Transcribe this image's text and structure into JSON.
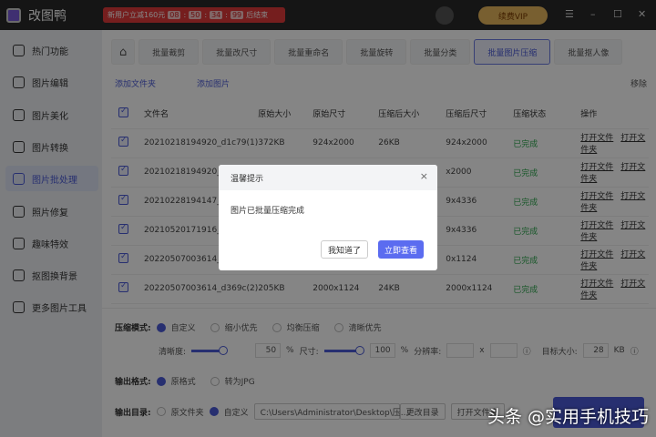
{
  "app": {
    "name": "改图鸭",
    "promo_text": "新用户立减160元",
    "countdown": [
      "08",
      "50",
      "34",
      "99"
    ],
    "promo_suffix": "后结束",
    "vip": "续费VIP",
    "window_controls": [
      "☰",
      "–",
      "☐",
      "✕"
    ]
  },
  "sidebar": {
    "items": [
      {
        "label": "热门功能"
      },
      {
        "label": "图片编辑"
      },
      {
        "label": "图片美化"
      },
      {
        "label": "图片转换"
      },
      {
        "label": "图片批处理",
        "active": true
      },
      {
        "label": "照片修复"
      },
      {
        "label": "趣味特效"
      },
      {
        "label": "抠图换背景"
      },
      {
        "label": "更多图片工具"
      }
    ]
  },
  "tabs": {
    "home": "⌂",
    "items": [
      "批量裁剪",
      "批量改尺寸",
      "批量重命名",
      "批量旋转",
      "批量分类",
      "批量图片压缩",
      "批量抠人像"
    ],
    "active": "批量图片压缩"
  },
  "toolbar": {
    "add_folder": "添加文件夹",
    "add_image": "添加图片",
    "remove": "移除"
  },
  "table": {
    "headers": [
      "文件名",
      "原始大小",
      "原始尺寸",
      "压缩后大小",
      "压缩后尺寸",
      "压缩状态",
      "操作"
    ],
    "rows": [
      {
        "name": "20210218194920_d1c79(1)",
        "size": "372KB",
        "dim": "924x2000",
        "csize": "26KB",
        "cdim": "924x2000",
        "status": "已完成"
      },
      {
        "name": "20210218194920_d1",
        "size": "",
        "dim": "",
        "csize": "",
        "cdim": "x2000",
        "status": "已完成"
      },
      {
        "name": "20210228194147_e1",
        "size": "",
        "dim": "",
        "csize": "",
        "cdim": "9x4336",
        "status": "已完成"
      },
      {
        "name": "20210520171916_19",
        "size": "",
        "dim": "",
        "csize": "",
        "cdim": "9x4336",
        "status": "已完成"
      },
      {
        "name": "20220507003614_d3",
        "size": "",
        "dim": "",
        "csize": "",
        "cdim": "0x1124",
        "status": "已完成"
      },
      {
        "name": "20220507003614_d369c(2)",
        "size": "205KB",
        "dim": "2000x1124",
        "csize": "24KB",
        "cdim": "2000x1124",
        "status": "已完成"
      }
    ],
    "open_file": "打开文件",
    "open_folder": "打开文件夹"
  },
  "settings": {
    "mode_label": "压缩模式:",
    "modes": [
      "自定义",
      "缩小优先",
      "均衡压缩",
      "清晰优先"
    ],
    "clarity_label": "清晰度:",
    "clarity_value": "50",
    "clarity_pct": 50,
    "size_label": "尺寸:",
    "size_value": "100",
    "size_pct": 100,
    "percent": "%",
    "resolution_label": "分辨率:",
    "x": "x",
    "target_label": "目标大小:",
    "target_value": "28",
    "target_unit": "KB",
    "format_label": "输出格式:",
    "formats": [
      "原格式",
      "转为JPG"
    ],
    "dir_label": "输出目录:",
    "dirs": [
      "原文件夹",
      "自定义"
    ],
    "path": "C:\\Users\\Administrator\\Desktop\\压...",
    "change_dir": "更改目录",
    "open_dir": "打开文件夹"
  },
  "dialog": {
    "title": "温馨提示",
    "close": "×",
    "message": "图片已批量压缩完成",
    "ok": "我知道了",
    "view": "立即查看"
  },
  "watermark": "头条 @实用手机技巧"
}
